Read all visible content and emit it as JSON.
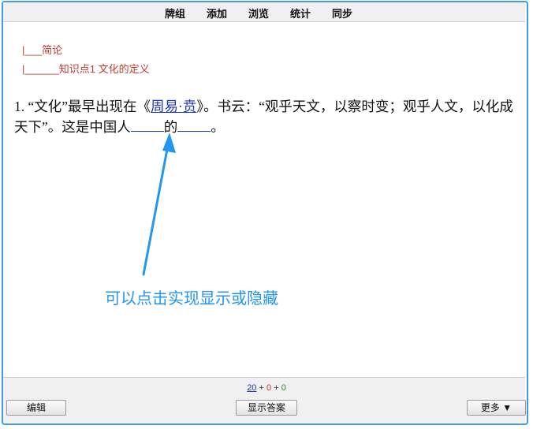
{
  "menu": {
    "items": [
      "牌组",
      "添加",
      "浏览",
      "统计",
      "同步"
    ]
  },
  "breadcrumbs": [
    "|___简论",
    "|______知识点1 文化的定义"
  ],
  "question": {
    "prefix": "1. “文化”最早出现在《",
    "link_text": "周易·贲",
    "middle": "》。书云：“观乎天文，以察时变；观乎人文，以化成天下”。这是中国人",
    "between_blanks": "的",
    "suffix": "。"
  },
  "annotation": {
    "text": "可以点击实现显示或隐藏",
    "color": "#2196f3"
  },
  "counts": {
    "new": "20",
    "plus1": "+",
    "learn": "0",
    "plus2": "+",
    "review": "0"
  },
  "buttons": {
    "edit": "编辑",
    "show_answer": "显示答案",
    "more": "更多 ▼"
  },
  "colors": {
    "frame": "#3d9bea",
    "breadcrumb": "#c0392b",
    "link": "#1a34c8"
  }
}
